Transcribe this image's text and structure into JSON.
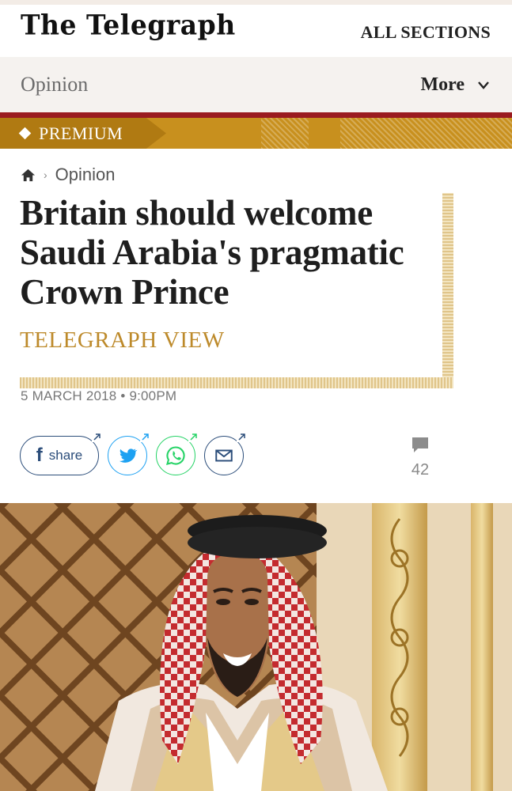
{
  "masthead": {
    "logo": "The Telegraph",
    "all_sections": "ALL SECTIONS"
  },
  "section_bar": {
    "section": "Opinion",
    "more": "More"
  },
  "premium": {
    "label": "PREMIUM"
  },
  "breadcrumb": {
    "crumb": "Opinion"
  },
  "article": {
    "headline": "Britain should welcome Saudi Arabia's pragmatic Crown Prince",
    "byline": "TELEGRAPH VIEW",
    "date": "5 MARCH 2018 • 9:00PM"
  },
  "share": {
    "facebook_label": "share"
  },
  "comments": {
    "count": "42"
  },
  "colors": {
    "brand_gold": "#bd8a2b",
    "premium_bg": "#c8901e",
    "premium_border": "#9a1b20",
    "share_blue": "#2b4d7a",
    "twitter_blue": "#1da1f2",
    "whatsapp_green": "#25d366",
    "email_navy": "#2b4d7a"
  },
  "icons": [
    "home-icon",
    "chevron-down-icon",
    "facebook-icon",
    "twitter-icon",
    "whatsapp-icon",
    "email-icon",
    "comment-icon",
    "external-arrow-icon"
  ]
}
